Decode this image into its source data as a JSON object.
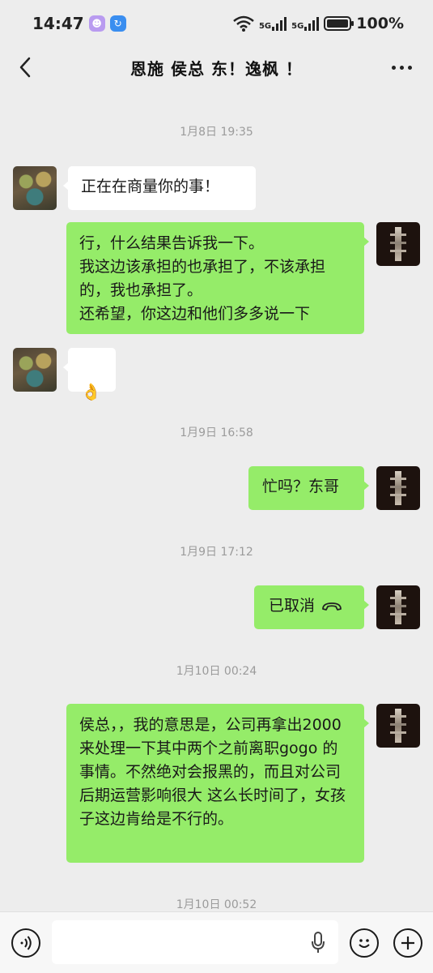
{
  "status_bar": {
    "time": "14:47",
    "signal_1": "5G",
    "signal_2": "5G",
    "battery": "100%",
    "icons": [
      "app-badge-icon",
      "sync-badge-icon",
      "wifi-icon",
      "signal-icon",
      "battery-icon"
    ]
  },
  "header": {
    "title": "恩施 侯总 东！逸枫 ！",
    "back_icon": "chevron-left-icon",
    "more_icon": "more-horizontal-icon"
  },
  "messages": [
    {
      "type": "timestamp",
      "text": "1月8日 19:35"
    },
    {
      "type": "in",
      "text": "正在在商量你的事！"
    },
    {
      "type": "out",
      "text": "行，什么结果告诉我一下。\n我这边该承担的也承担了，不该承担的，我也承担了。\n还希望，你这边和他们多多说一下"
    },
    {
      "type": "in",
      "text": "👌"
    },
    {
      "type": "timestamp",
      "text": "1月9日 16:58"
    },
    {
      "type": "out",
      "text": "忙吗？东哥"
    },
    {
      "type": "timestamp",
      "text": "1月9日 17:12"
    },
    {
      "type": "out",
      "text": "已取消",
      "icon": "phone-hangup-icon"
    },
    {
      "type": "timestamp",
      "text": "1月10日 00:24"
    },
    {
      "type": "out",
      "text": "侯总，，我的意思是，公司再拿出2000 来处理一下其中两个之前离职gogo 的事情。不然绝对会报黑的，而且对公司后期运营影响很大\n这么长时间了，女孩子这边肯给是不行的。"
    },
    {
      "type": "timestamp",
      "text": "1月10日 00:52"
    }
  ],
  "input_bar": {
    "placeholder": "",
    "icons": [
      "voice-icon",
      "mic-icon",
      "emoji-icon",
      "plus-icon"
    ]
  },
  "colors": {
    "background": "#ededed",
    "bubble_out": "#95ec69",
    "bubble_in": "#ffffff"
  }
}
